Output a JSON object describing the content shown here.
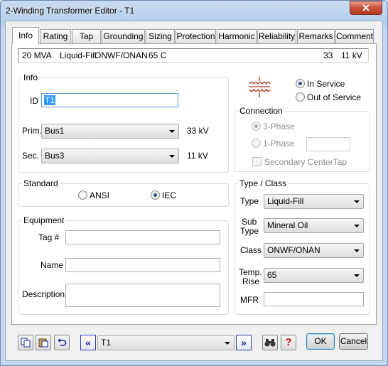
{
  "window": {
    "title": "2-Winding Transformer Editor - T1",
    "close_glyph": "✕"
  },
  "tabs": [
    {
      "label": "Info"
    },
    {
      "label": "Rating"
    },
    {
      "label": "Tap"
    },
    {
      "label": "Grounding"
    },
    {
      "label": "Sizing"
    },
    {
      "label": "Protection"
    },
    {
      "label": "Harmonic"
    },
    {
      "label": "Reliability"
    },
    {
      "label": "Remarks"
    },
    {
      "label": "Comment"
    }
  ],
  "summary": {
    "mva": "20 MVA",
    "fill": "Liquid-Fill",
    "cooling": "ONWF/ONAN",
    "temp": "65 C",
    "prim_kv": "33",
    "sec_kv": "11 kV"
  },
  "info": {
    "group_label": "Info",
    "id_label": "ID",
    "id_value": "T1",
    "prim_label": "Prim.",
    "prim_value": "Bus1",
    "prim_kv": "33 kV",
    "sec_label": "Sec.",
    "sec_value": "Bus3",
    "sec_kv": "11 kV"
  },
  "service": {
    "in_service": "In Service",
    "out_of_service": "Out of Service",
    "selected": "In Service"
  },
  "connection": {
    "group_label": "Connection",
    "three_phase": "3-Phase",
    "one_phase": "1-Phase",
    "secondary_centertap": "Secondary CenterTap",
    "selected": "3-Phase"
  },
  "standard": {
    "group_label": "Standard",
    "ansi": "ANSI",
    "iec": "IEC",
    "selected": "IEC"
  },
  "type_class": {
    "group_label": "Type / Class",
    "type_label": "Type",
    "type_value": "Liquid-Fill",
    "subtype_label_1": "Sub",
    "subtype_label_2": "Type",
    "subtype_value": "Mineral Oil",
    "class_label": "Class",
    "class_value": "ONWF/ONAN",
    "temp_label_1": "Temp.",
    "temp_label_2": "Rise",
    "temp_value": "65",
    "mfr_label": "MFR",
    "mfr_value": ""
  },
  "equipment": {
    "group_label": "Equipment",
    "tag_label": "Tag #",
    "tag_value": "",
    "name_label": "Name",
    "name_value": "",
    "desc_label": "Description",
    "desc_value": ""
  },
  "footer": {
    "selector_value": "T1",
    "ok_label": "OK",
    "cancel_label": "Cancel"
  },
  "colors": {
    "accent": "#1a2b9a",
    "help": "#cc1111",
    "transformer_symbol": "#b03020"
  }
}
